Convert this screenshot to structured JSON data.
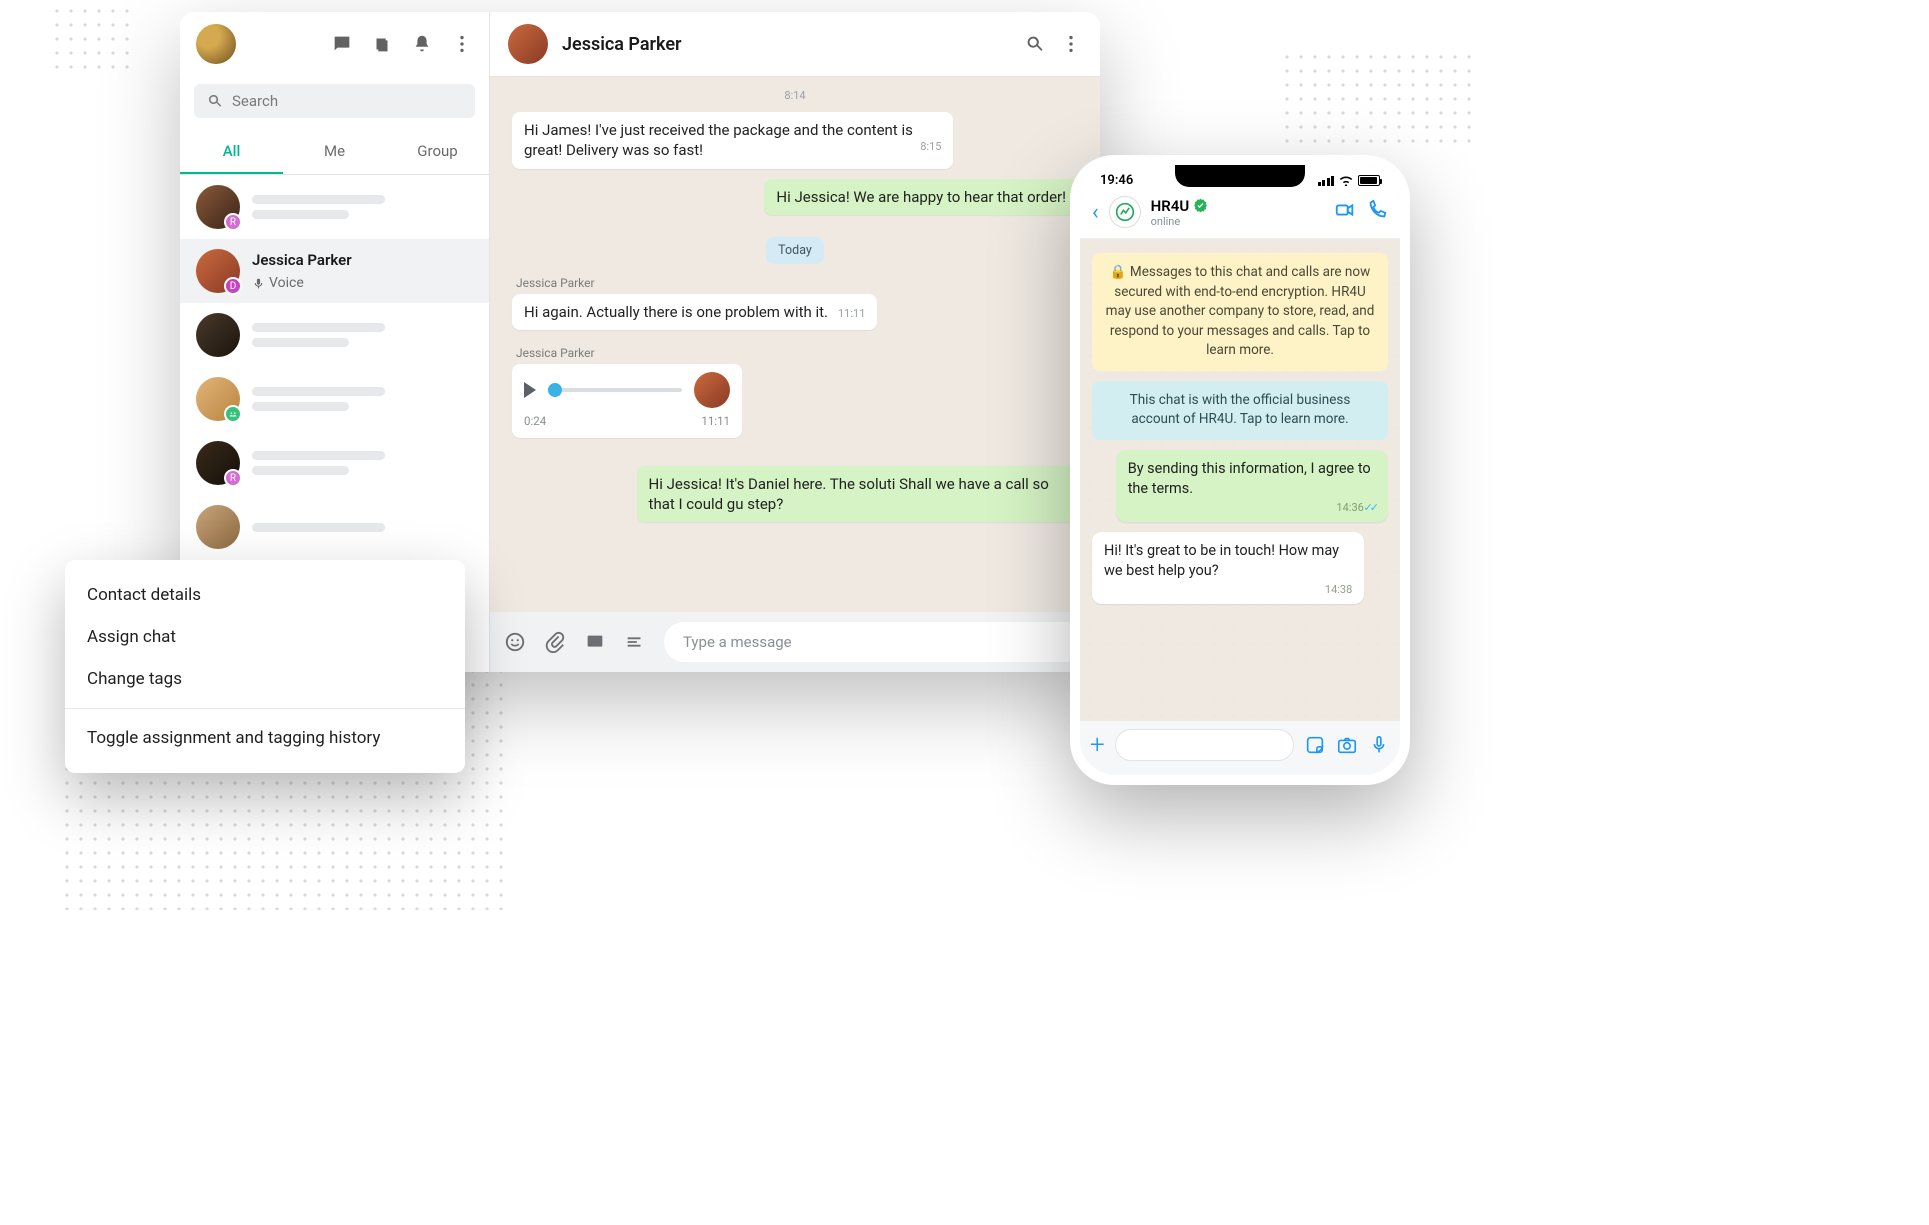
{
  "sidebar": {
    "search_placeholder": "Search",
    "tabs": [
      "All",
      "Me",
      "Group"
    ],
    "active_tab": 0,
    "items": [
      {
        "badge": "R",
        "badge_color": "#d66bd2"
      },
      {
        "name": "Jessica Parker",
        "sub": "Voice",
        "badge": "D",
        "badge_color": "#c542c1",
        "selected": true
      },
      {},
      {
        "badge": "",
        "badge_color": "#36c27a"
      },
      {
        "badge": "R",
        "badge_color": "#d66bd2"
      },
      {}
    ]
  },
  "chat": {
    "title": "Jessica Parker",
    "top_time": "8:14",
    "msgs": [
      {
        "who": "in",
        "text": "Hi James! I've just received the package and the content is great! Delivery was so fast!",
        "t": "8:15"
      },
      {
        "who": "out",
        "text": "Hi Jessica! We are happy to hear that order!"
      },
      {
        "who": "pill",
        "text": "Today"
      },
      {
        "sender": "Jessica Parker",
        "who": "in",
        "text": "Hi again. Actually there is one problem with it.",
        "t": "11:11"
      },
      {
        "sender": "Jessica Parker",
        "who": "voice",
        "dur": "0:24",
        "t": "11:11"
      },
      {
        "who": "out",
        "text": "Hi Jessica! It's Daniel here. The soluti Shall we have a call so that I could gu step?"
      }
    ],
    "input_placeholder": "Type a message"
  },
  "ctx": {
    "items": [
      "Contact details",
      "Assign chat",
      "Change tags"
    ],
    "footer": "Toggle assignment and tagging history"
  },
  "phone": {
    "time": "19:46",
    "biz": "HR4U",
    "status": "online",
    "notice": "🔒 Messages to this chat and calls are now secured with end-to-end encryption. HR4U may use another company to store, read, and respond to your messages and calls. Tap to learn more.",
    "biznote": "This chat is with the official business account of HR4U. Tap to learn more.",
    "out": {
      "text": "By sending this information, I agree to the terms.",
      "t": "14:36"
    },
    "in": {
      "text": "Hi! It's great to be in touch! How may we best help you?",
      "t": "14:38"
    }
  }
}
